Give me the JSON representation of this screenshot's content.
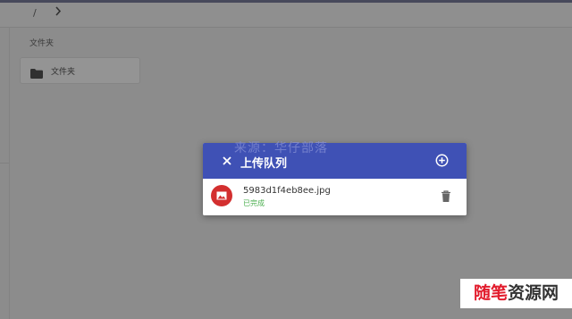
{
  "breadcrumb": {
    "root": "/",
    "chevron": "chevron-right-icon"
  },
  "main": {
    "section_title": "文件夹",
    "folders": [
      {
        "name": "文件夹",
        "icon": "folder-icon"
      }
    ]
  },
  "upload_dialog": {
    "title": "上传队列",
    "close_icon": "close-icon",
    "add_icon": "add-circle-icon",
    "header_color": "#3f51b5",
    "items": [
      {
        "filename": "5983d1f4eb8ee.jpg",
        "status": "已完成",
        "status_color": "#4caf50",
        "thumb_color": "#d32f2f",
        "thumb_icon": "image-icon",
        "delete_icon": "delete-icon"
      }
    ]
  },
  "watermarks": {
    "center": "来源：华仔部落",
    "corner_red": "随笔",
    "corner_dark": "资源网"
  }
}
